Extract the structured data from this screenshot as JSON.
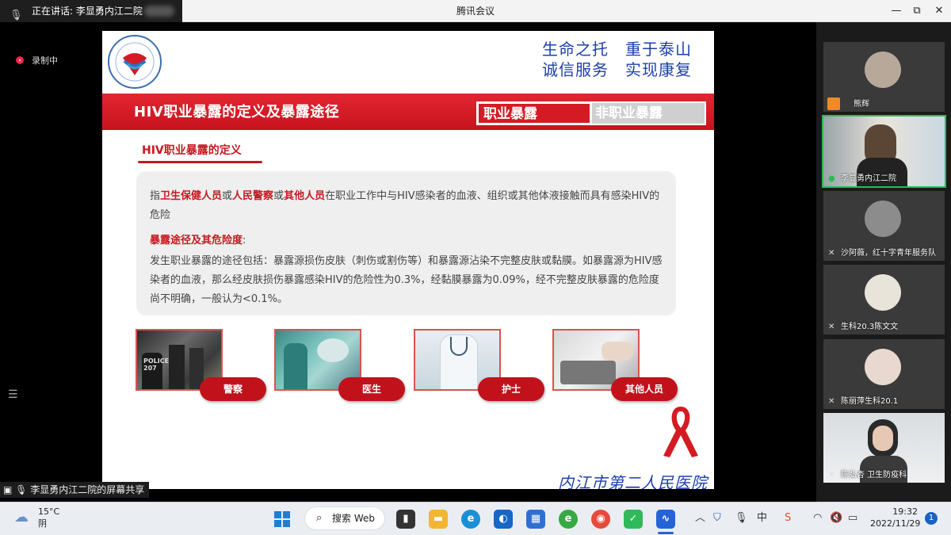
{
  "titlebar": {
    "speaker_text": "正在讲话: 李显勇内江二院",
    "window_title": "腾讯会议",
    "min_icon": "—",
    "restore_icon": "⧉",
    "close_icon": "✕"
  },
  "stage": {
    "recording_label": "录制中",
    "menu_icon": "☰",
    "share_label": "李显勇内江二院的屏幕共享"
  },
  "slide": {
    "motto_line1": "生命之托　重于泰山",
    "motto_line2": "诚信服务　实现康复",
    "banner_title": "HIV职业暴露的定义及暴露途径",
    "tab_occupational": "职业暴露",
    "tab_non_occupational": "非职业暴露",
    "section_title": "HIV职业暴露的定义",
    "def_prefix": "指",
    "def_role1": "卫生保健人员",
    "def_or1": "或",
    "def_role2": "人民警察",
    "def_or2": "或",
    "def_role3": "其他人员",
    "def_rest": "在职业工作中与HIV感染者的血液、组织或其他体液接触而具有感染HIV的危险",
    "route_heading": "暴露途径及其危险度",
    "route_colon": ":",
    "route_text": "发生职业暴露的途径包括：暴露源损伤皮肤（刺伤或割伤等）和暴露源沾染不完整皮肤或黏膜。如暴露源为HIV感染者的血液，那么经皮肤损伤暴露感染HIV的危险性为0.3%，经黏膜暴露为0.09%，经不完整皮肤暴露的危险度尚不明确，一般认为<0.1%。",
    "police_sign": "POLICE",
    "police_number": "207",
    "roles": [
      "警察",
      "医生",
      "护士",
      "其他人员"
    ],
    "hospital_name": "内江市第二人民医院"
  },
  "participants": [
    {
      "name": "熊辉"
    },
    {
      "name": "李显勇内江二院"
    },
    {
      "name": "沙阿薇，红十字青年服务队"
    },
    {
      "name": "生科20.3陈文文"
    },
    {
      "name": "陈丽萍生科20.1"
    },
    {
      "name": "陈弘杏 卫生防疫科"
    }
  ],
  "taskbar": {
    "temperature": "15°C",
    "condition": "阴",
    "search_label": "搜索 Web",
    "time": "19:32",
    "date": "2022/11/29",
    "notification_count": "1"
  },
  "colors": {
    "brand_red": "#d41b24",
    "motto_blue": "#1d3fae",
    "active_green": "#2fb95a"
  }
}
